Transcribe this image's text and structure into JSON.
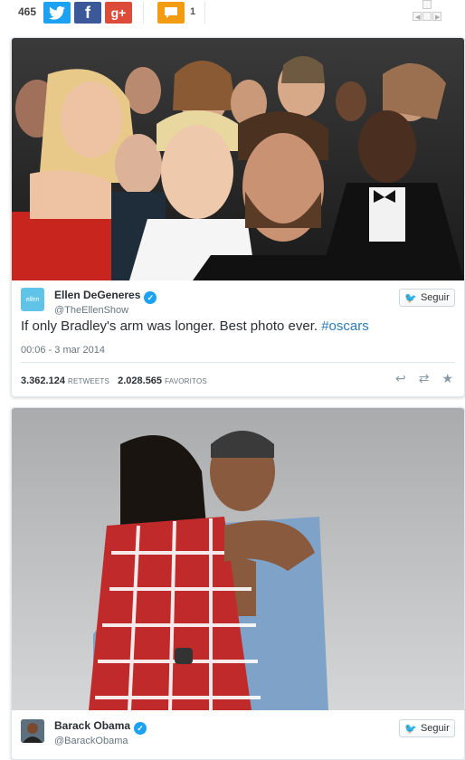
{
  "sharebar": {
    "count": "465",
    "twitter_icon": "bird-icon",
    "facebook_icon": "f",
    "google_icon": "g+",
    "comments_count": "1"
  },
  "tweets": [
    {
      "name": "Ellen DeGeneres",
      "handle": "@TheEllenShow",
      "avatar_text": "ellen",
      "follow_label": "Seguir",
      "text": "If only Bradley's arm was longer. Best photo ever. ",
      "hashtag": "#oscars",
      "date": "00:06 - 3 mar 2014",
      "retweets": "3.362.124",
      "retweets_label": "RETWEETS",
      "favorites": "2.028.565",
      "favorites_label": "FAVORITOS"
    },
    {
      "name": "Barack Obama",
      "handle": "@BarackObama",
      "follow_label": "Seguir"
    }
  ],
  "colors": {
    "twitter": "#1da1f2",
    "facebook": "#3b5998",
    "google": "#dd4b39",
    "comment": "#f39c12",
    "hashtag": "#2b7bb9"
  }
}
